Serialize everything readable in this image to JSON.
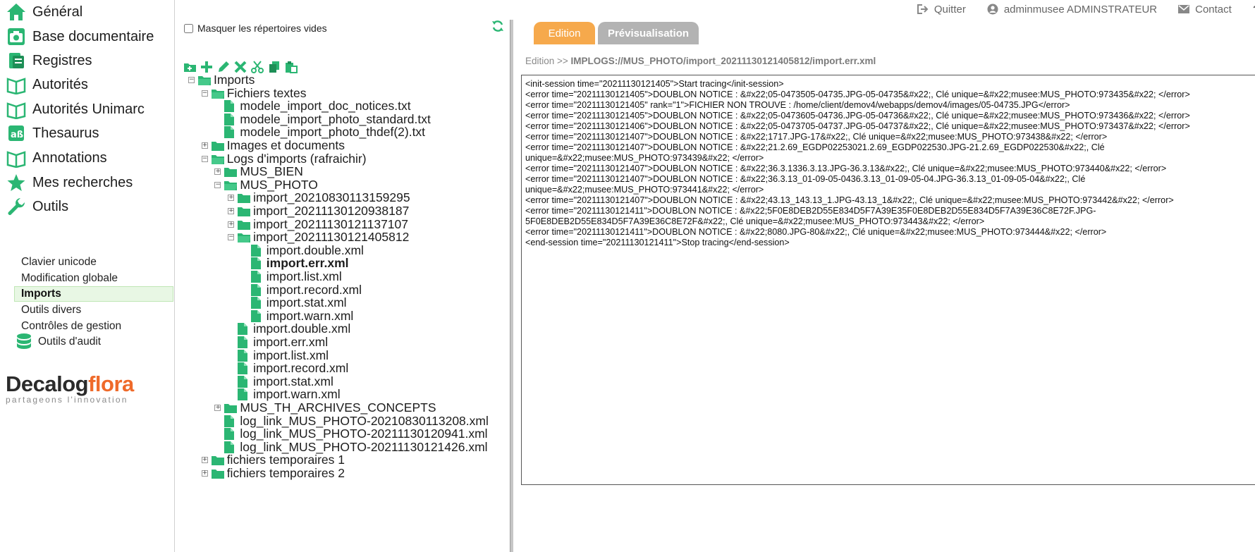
{
  "nav": {
    "items": [
      {
        "label": "Général",
        "icon": "home-icon"
      },
      {
        "label": "Base documentaire",
        "icon": "camera-icon"
      },
      {
        "label": "Registres",
        "icon": "registry-icon"
      },
      {
        "label": "Autorités",
        "icon": "book-icon"
      },
      {
        "label": "Autorités Unimarc",
        "icon": "book-icon"
      },
      {
        "label": "Thesaurus",
        "icon": "thesaurus-icon"
      },
      {
        "label": "Annotations",
        "icon": "book-icon"
      },
      {
        "label": "Mes recherches",
        "icon": "star-icon"
      },
      {
        "label": "Outils",
        "icon": "wrench-icon"
      }
    ],
    "subitems": [
      {
        "label": "Clavier unicode"
      },
      {
        "label": "Modification globale"
      },
      {
        "label": "Imports"
      },
      {
        "label": "Outils divers"
      },
      {
        "label": "Contrôles de gestion"
      },
      {
        "label": "Outils d'audit"
      }
    ],
    "logo": {
      "brand_part1": "Decalog",
      "brand_part2": "flora",
      "tagline": "partageons l'innovation"
    }
  },
  "tree": {
    "hide_empty_label": "Masquer les répertoires vides",
    "nodes": [
      {
        "label": "Imports",
        "type": "folder",
        "exp": "−"
      },
      {
        "label": "Fichiers textes",
        "type": "folder",
        "exp": "−"
      },
      {
        "label": "modele_import_doc_notices.txt",
        "type": "file",
        "exp": ""
      },
      {
        "label": "modele_import_photo_standard.txt",
        "type": "file",
        "exp": ""
      },
      {
        "label": "modele_import_photo_thdef(2).txt",
        "type": "file",
        "exp": ""
      },
      {
        "label": "Images et documents",
        "type": "folder",
        "exp": "+"
      },
      {
        "label": "Logs d'imports (rafraichir)",
        "type": "folder",
        "exp": "−"
      },
      {
        "label": "MUS_BIEN",
        "type": "folder",
        "exp": "+"
      },
      {
        "label": "MUS_PHOTO",
        "type": "folder",
        "exp": "−"
      },
      {
        "label": "import_20210830113159295",
        "type": "folder",
        "exp": "+"
      },
      {
        "label": "import_20211130120938187",
        "type": "folder",
        "exp": "+"
      },
      {
        "label": "import_20211130121137107",
        "type": "folder",
        "exp": "+"
      },
      {
        "label": "import_20211130121405812",
        "type": "folder",
        "exp": "−"
      },
      {
        "label": "import.double.xml",
        "type": "file",
        "exp": ""
      },
      {
        "label": "import.err.xml",
        "type": "file",
        "exp": ""
      },
      {
        "label": "import.list.xml",
        "type": "file",
        "exp": ""
      },
      {
        "label": "import.record.xml",
        "type": "file",
        "exp": ""
      },
      {
        "label": "import.stat.xml",
        "type": "file",
        "exp": ""
      },
      {
        "label": "import.warn.xml",
        "type": "file",
        "exp": ""
      },
      {
        "label": "import.double.xml",
        "type": "file",
        "exp": ""
      },
      {
        "label": "import.err.xml",
        "type": "file",
        "exp": ""
      },
      {
        "label": "import.list.xml",
        "type": "file",
        "exp": ""
      },
      {
        "label": "import.record.xml",
        "type": "file",
        "exp": ""
      },
      {
        "label": "import.stat.xml",
        "type": "file",
        "exp": ""
      },
      {
        "label": "import.warn.xml",
        "type": "file",
        "exp": ""
      },
      {
        "label": "MUS_TH_ARCHIVES_CONCEPTS",
        "type": "folder",
        "exp": "+"
      },
      {
        "label": "log_link_MUS_PHOTO-20210830113208.xml",
        "type": "file",
        "exp": ""
      },
      {
        "label": "log_link_MUS_PHOTO-20211130120941.xml",
        "type": "file",
        "exp": ""
      },
      {
        "label": "log_link_MUS_PHOTO-20211130121426.xml",
        "type": "file",
        "exp": ""
      },
      {
        "label": "fichiers temporaires 1",
        "type": "folder",
        "exp": "+"
      },
      {
        "label": "fichiers temporaires 2",
        "type": "folder",
        "exp": "+"
      }
    ]
  },
  "topbar": {
    "quit": "Quitter",
    "user": "adminmusee ADMINSTRATEUR",
    "contact": "Contact",
    "help": "?"
  },
  "tabs": {
    "edit": "Edition",
    "preview": "Prévisualisation"
  },
  "edit_path": {
    "prefix": "Edition >> ",
    "path": "IMPLOGS://MUS_PHOTO/import_20211130121405812/import.err.xml"
  },
  "editor": {
    "lines": [
      "<init-session time=\"20211130121405\">Start tracing</init-session>",
      "<error time=\"20211130121405\">DOUBLON NOTICE : &#x22;05-0473505-04735.JPG-05-04735&#x22;, Clé unique=&#x22;musee:MUS_PHOTO:973435&#x22; </error>",
      "<error time=\"20211130121405\" rank=\"1\">FICHIER NON TROUVE : /home/client/demov4/webapps/demov4/images/05-04735.JPG</error>",
      "<error time=\"20211130121405\">DOUBLON NOTICE : &#x22;05-0473605-04736.JPG-05-04736&#x22;, Clé unique=&#x22;musee:MUS_PHOTO:973436&#x22; </error>",
      "<error time=\"20211130121406\">DOUBLON NOTICE : &#x22;05-0473705-04737.JPG-05-04737&#x22;, Clé unique=&#x22;musee:MUS_PHOTO:973437&#x22; </error>",
      "<error time=\"20211130121407\">DOUBLON NOTICE : &#x22;1717.JPG-17&#x22;, Clé unique=&#x22;musee:MUS_PHOTO:973438&#x22; </error>",
      "<error time=\"20211130121407\">DOUBLON NOTICE : &#x22;21.2.69_EGDP02253021.2.69_EGDP022530.JPG-21.2.69_EGDP022530&#x22;, Clé unique=&#x22;musee:MUS_PHOTO:973439&#x22; </error>",
      "<error time=\"20211130121407\">DOUBLON NOTICE : &#x22;36.3.1336.3.13.JPG-36.3.13&#x22;, Clé unique=&#x22;musee:MUS_PHOTO:973440&#x22; </error>",
      "<error time=\"20211130121407\">DOUBLON NOTICE : &#x22;36.3.13_01-09-05-0436.3.13_01-09-05-04.JPG-36.3.13_01-09-05-04&#x22;, Clé unique=&#x22;musee:MUS_PHOTO:973441&#x22; </error>",
      "<error time=\"20211130121407\">DOUBLON NOTICE : &#x22;43.13_143.13_1.JPG-43.13_1&#x22;, Clé unique=&#x22;musee:MUS_PHOTO:973442&#x22; </error>",
      "<error time=\"20211130121411\">DOUBLON NOTICE : &#x22;5F0E8DEB2D55E834D5F7A39E35F0E8DEB2D55E834D5F7A39E36C8E72F.JPG-5F0E8DEB2D55E834D5F7A39E36C8E72F&#x22;, Clé unique=&#x22;musee:MUS_PHOTO:973443&#x22; </error>",
      "<error time=\"20211130121411\">DOUBLON NOTICE : &#x22;8080.JPG-80&#x22;, Clé unique=&#x22;musee:MUS_PHOTO:973444&#x22; </error>",
      "<end-session time=\"20211130121411\">Stop tracing</end-session>"
    ]
  }
}
